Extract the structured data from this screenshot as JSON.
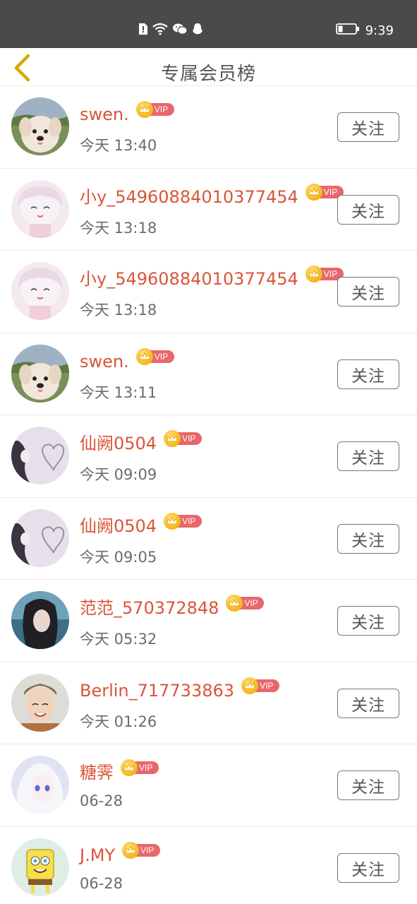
{
  "status_bar": {
    "time": "9:39",
    "icons": [
      "alert-icon",
      "wifi-icon",
      "wechat-icon",
      "qq-icon"
    ],
    "battery_icon": "battery-icon"
  },
  "header": {
    "title": "专属会员榜",
    "back_icon": "chevron-left-icon",
    "accent_color": "#d8a800"
  },
  "vip_label": "VIP",
  "follow_label": "关注",
  "colors": {
    "name": "#d9553a",
    "vip_pill": "#e8676a",
    "status_bar": "#4a4a4a"
  },
  "members": [
    {
      "name": "swen.",
      "time": "今天 13:40",
      "avatar": "puppy-avatar"
    },
    {
      "name": "小y_54960884010377454",
      "time": "今天 13:18",
      "avatar": "anime-girl-avatar"
    },
    {
      "name": "小y_54960884010377454",
      "time": "今天 13:18",
      "avatar": "anime-girl-avatar"
    },
    {
      "name": "swen.",
      "time": "今天 13:11",
      "avatar": "puppy-avatar"
    },
    {
      "name": "仙阙0504",
      "time": "今天 09:09",
      "avatar": "heart-drawing-avatar"
    },
    {
      "name": "仙阙0504",
      "time": "今天 09:05",
      "avatar": "heart-drawing-avatar"
    },
    {
      "name": "范范_570372848",
      "time": "今天 05:32",
      "avatar": "girl-portrait-avatar"
    },
    {
      "name": "Berlin_717733863",
      "time": "今天 01:26",
      "avatar": "smiling-person-avatar"
    },
    {
      "name": "糖霁",
      "time": "06-28",
      "avatar": "white-hair-anime-avatar"
    },
    {
      "name": "J.MY",
      "time": "06-28",
      "avatar": "spongebob-avatar"
    }
  ]
}
